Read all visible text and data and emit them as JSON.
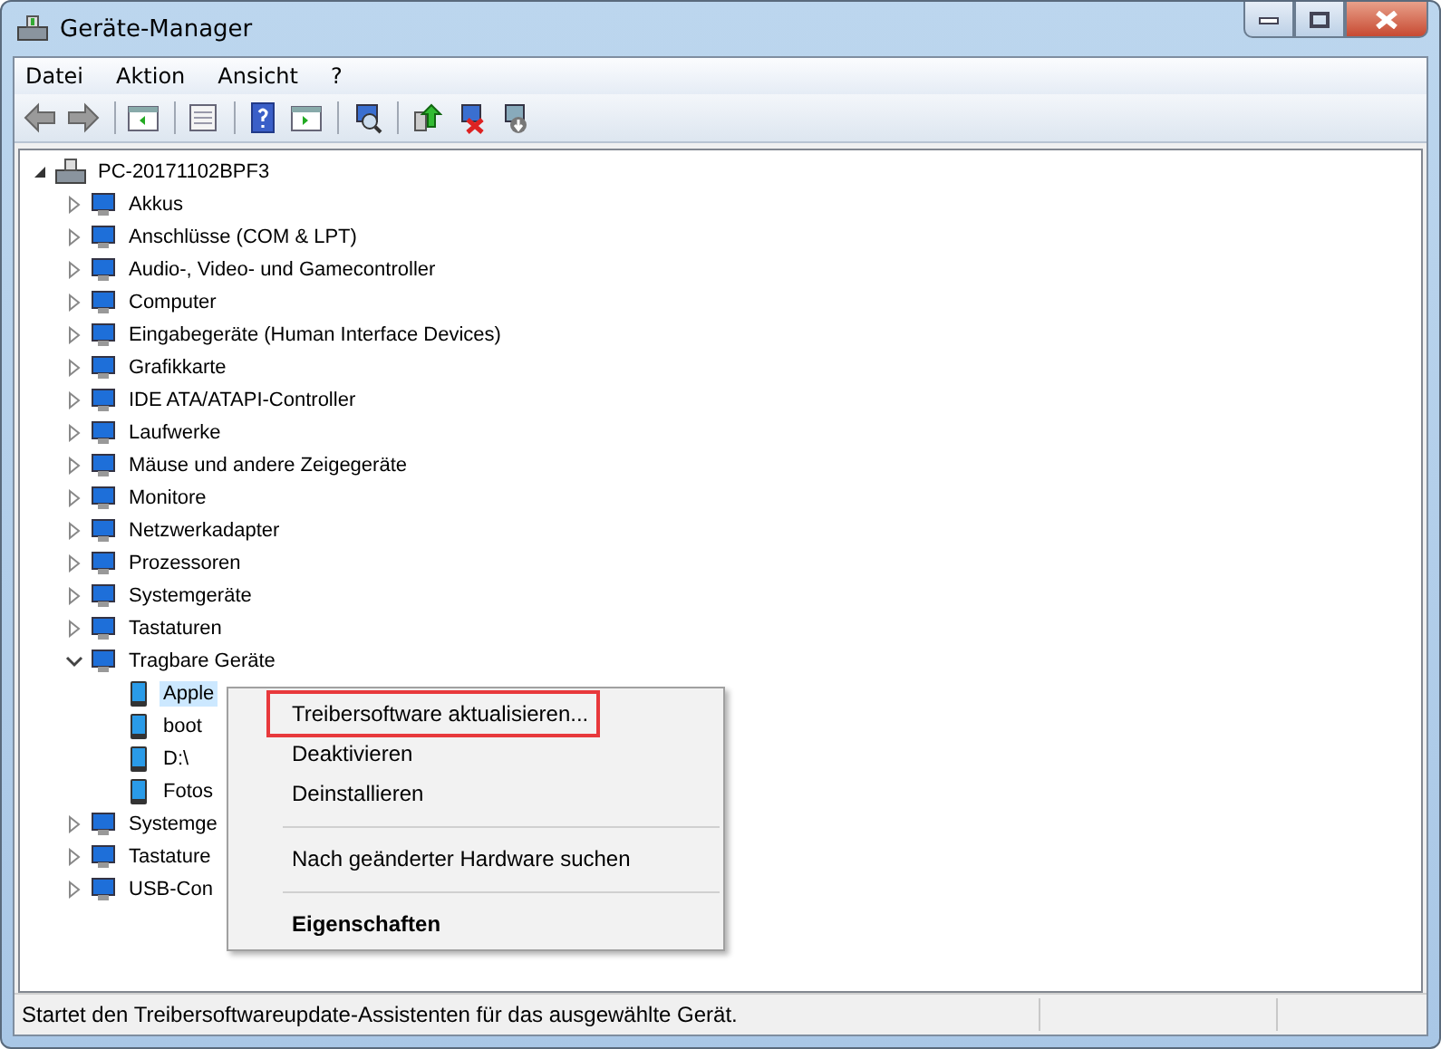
{
  "window": {
    "title": "Geräte-Manager"
  },
  "menu_bar": [
    "Datei",
    "Aktion",
    "Ansicht",
    "?"
  ],
  "tree": {
    "label": "PC-20171102BPF3",
    "expanded": true,
    "selected": false,
    "children": [
      {
        "label": "Akkus",
        "expanded": false,
        "selected": false
      },
      {
        "label": "Anschlüsse (COM & LPT)",
        "expanded": false,
        "selected": false
      },
      {
        "label": "Audio-, Video- und Gamecontroller",
        "expanded": false,
        "selected": false
      },
      {
        "label": "Computer",
        "expanded": false,
        "selected": false
      },
      {
        "label": "Eingabegeräte (Human Interface Devices)",
        "expanded": false,
        "selected": false
      },
      {
        "label": "Grafikkarte",
        "expanded": false,
        "selected": false
      },
      {
        "label": "IDE ATA/ATAPI-Controller",
        "expanded": false,
        "selected": false
      },
      {
        "label": "Laufwerke",
        "expanded": false,
        "selected": false
      },
      {
        "label": "Mäuse und andere Zeigegeräte",
        "expanded": false,
        "selected": false
      },
      {
        "label": "Monitore",
        "expanded": false,
        "selected": false
      },
      {
        "label": "Netzwerkadapter",
        "expanded": false,
        "selected": false
      },
      {
        "label": "Prozessoren",
        "expanded": false,
        "selected": false
      },
      {
        "label": "Systemgeräte",
        "expanded": false,
        "selected": false
      },
      {
        "label": "Tastaturen",
        "expanded": false,
        "selected": false
      },
      {
        "label": "Tragbare Geräte",
        "expanded": true,
        "selected": false,
        "children": [
          {
            "label": "Apple",
            "selected": true
          },
          {
            "label": "boot",
            "selected": false
          },
          {
            "label": "D:\\",
            "selected": false
          },
          {
            "label": "Fotos",
            "selected": false
          }
        ]
      },
      {
        "label": "Systemge",
        "expanded": false,
        "selected": false
      },
      {
        "label": "Tastature",
        "expanded": false,
        "selected": false
      },
      {
        "label": "USB-Con",
        "expanded": false,
        "selected": false
      }
    ]
  },
  "context_menu": [
    {
      "kind": "item",
      "label": "Treibersoftware aktualisieren...",
      "highlighted": true,
      "default": false
    },
    {
      "kind": "item",
      "label": "Deaktivieren",
      "highlighted": false,
      "default": false
    },
    {
      "kind": "item",
      "label": "Deinstallieren",
      "highlighted": false,
      "default": false
    },
    {
      "kind": "separator"
    },
    {
      "kind": "item",
      "label": "Nach geänderter Hardware suchen",
      "highlighted": false,
      "default": false
    },
    {
      "kind": "separator"
    },
    {
      "kind": "item",
      "label": "Eigenschaften",
      "highlighted": false,
      "default": true
    }
  ],
  "status_bar": "Startet den Treibersoftwareupdate-Assistenten für das ausgewählte Gerät."
}
